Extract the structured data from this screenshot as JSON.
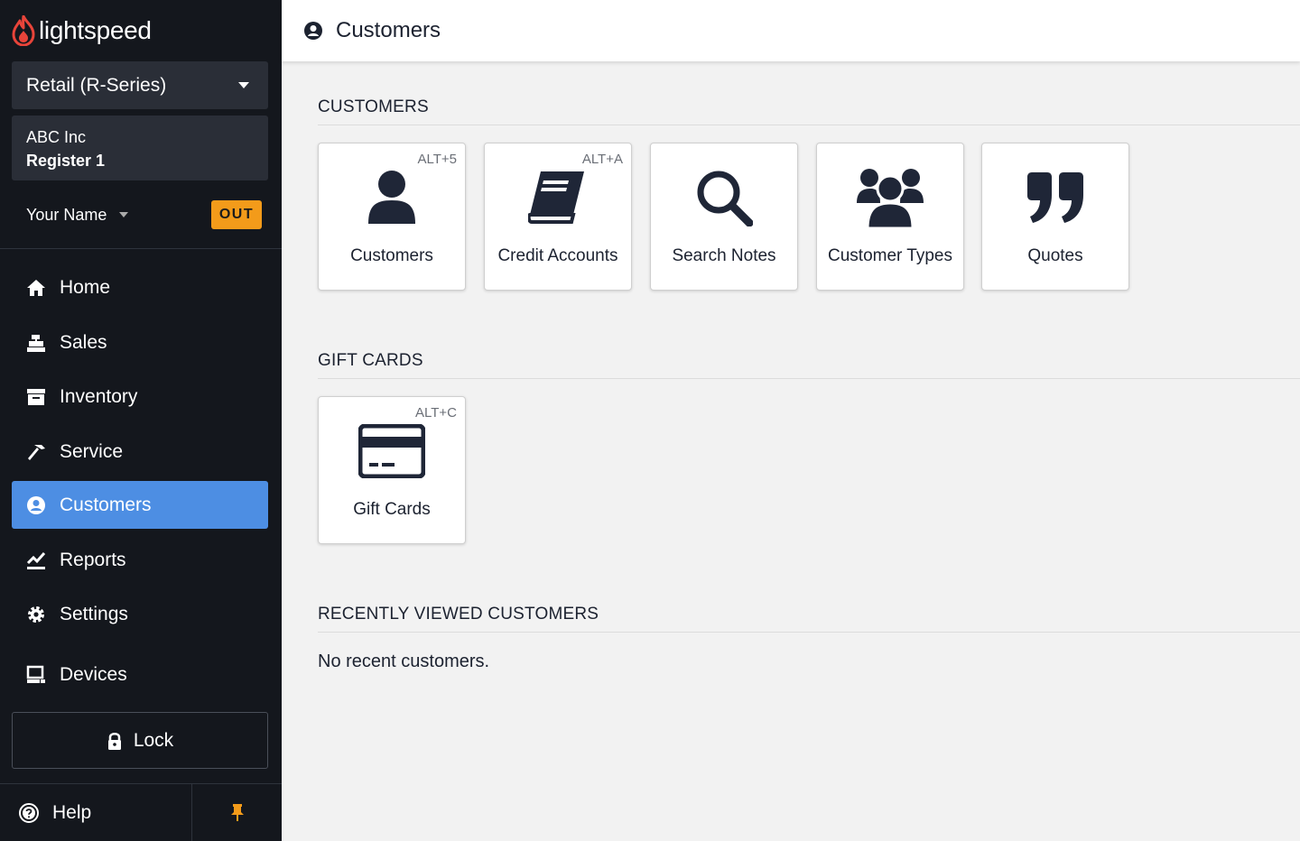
{
  "brand": {
    "name": "lightspeed",
    "accent": "#e8443a"
  },
  "sidebar": {
    "series": "Retail (R-Series)",
    "store": "ABC Inc",
    "register": "Register 1",
    "user": "Your Name",
    "clock_status": "OUT",
    "items": [
      {
        "label": "Home",
        "icon": "home-icon"
      },
      {
        "label": "Sales",
        "icon": "register-icon"
      },
      {
        "label": "Inventory",
        "icon": "inventory-icon"
      },
      {
        "label": "Service",
        "icon": "hammer-icon"
      },
      {
        "label": "Customers",
        "icon": "user-circle-icon",
        "active": true
      },
      {
        "label": "Reports",
        "icon": "chart-icon"
      },
      {
        "label": "Settings",
        "icon": "gear-icon"
      },
      {
        "label": "Devices",
        "icon": "devices-icon"
      }
    ],
    "lock_label": "Lock",
    "help_label": "Help",
    "active_color": "#4d8ee3"
  },
  "header": {
    "title": "Customers"
  },
  "main": {
    "customers_section": {
      "title": "CUSTOMERS",
      "tiles": [
        {
          "label": "Customers",
          "shortcut": "ALT+5",
          "icon": "user-icon"
        },
        {
          "label": "Credit Accounts",
          "shortcut": "ALT+A",
          "icon": "book-icon"
        },
        {
          "label": "Search Notes",
          "shortcut": "",
          "icon": "search-icon"
        },
        {
          "label": "Customer Types",
          "shortcut": "",
          "icon": "users-icon"
        },
        {
          "label": "Quotes",
          "shortcut": "",
          "icon": "quote-icon"
        }
      ]
    },
    "gift_cards_section": {
      "title": "GIFT CARDS",
      "tiles": [
        {
          "label": "Gift Cards",
          "shortcut": "ALT+C",
          "icon": "credit-card-icon"
        }
      ]
    },
    "recent_section": {
      "title": "RECENTLY VIEWED CUSTOMERS",
      "empty_text": "No recent customers."
    }
  }
}
